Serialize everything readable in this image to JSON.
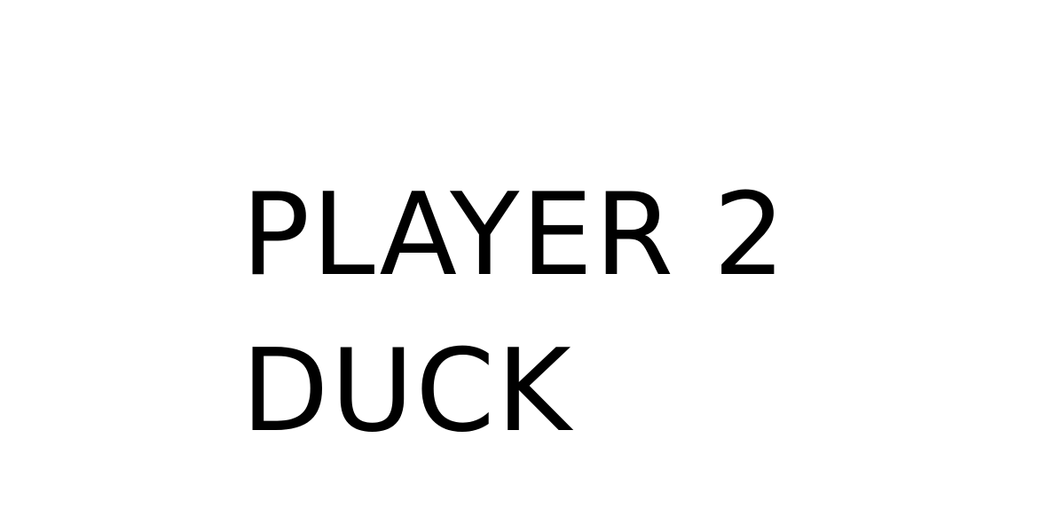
{
  "screen": {
    "lines": [
      "PLAYER 2",
      "DUCK"
    ]
  },
  "colors": {
    "background": "#ffffff",
    "text": "#000000"
  }
}
